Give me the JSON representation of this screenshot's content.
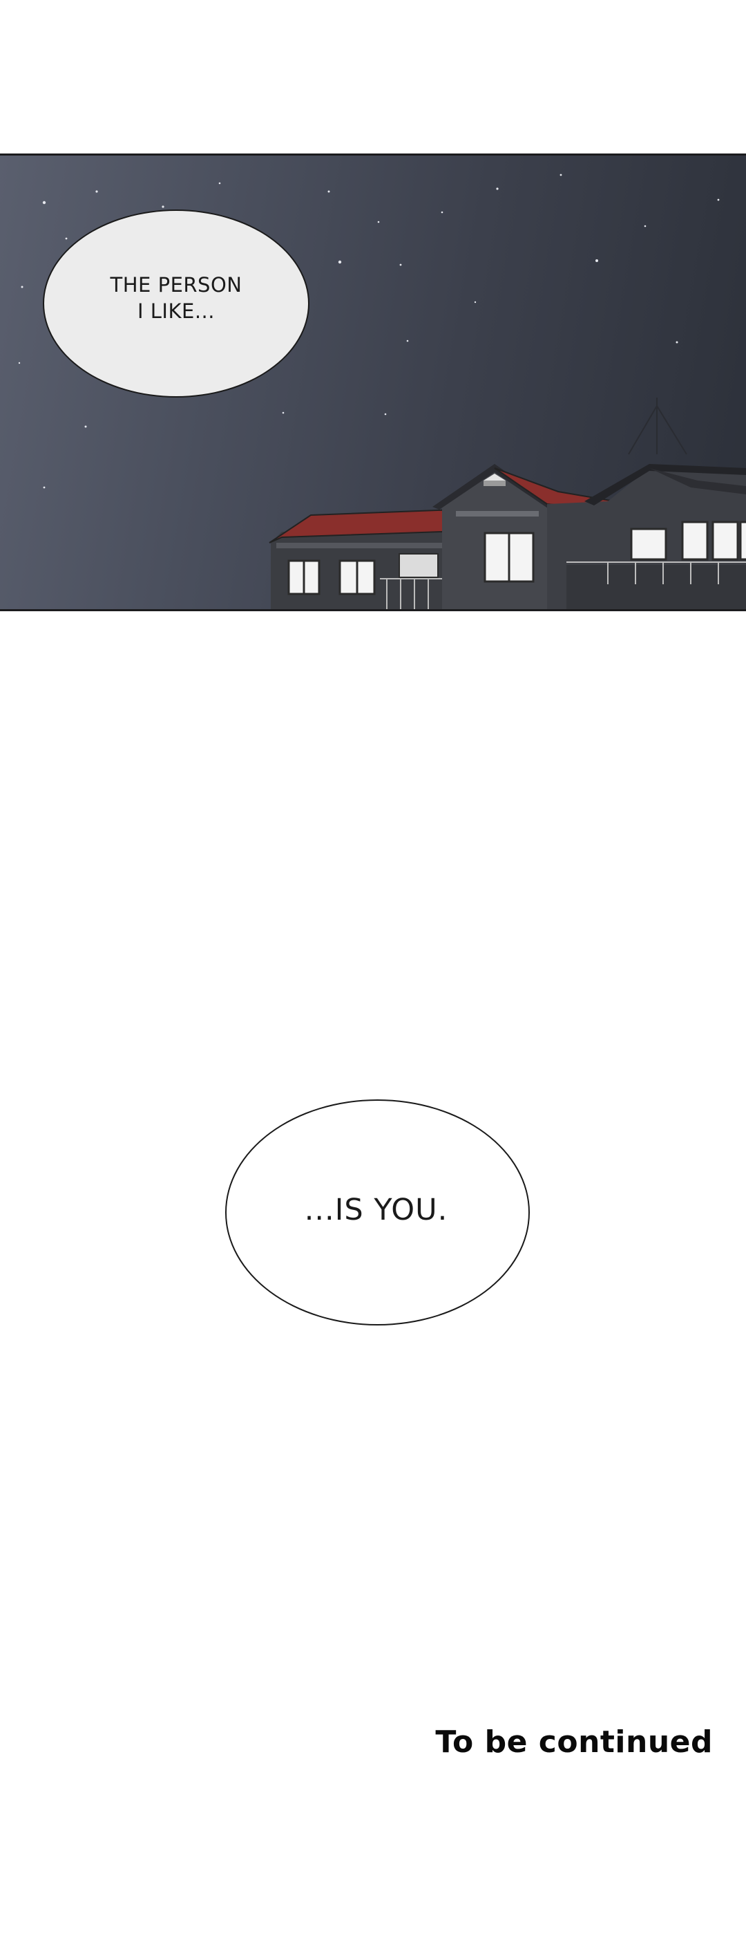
{
  "panel": {
    "description_icon": "night-sky-houses-illustration",
    "colors": {
      "sky_top": "#5a5f6e",
      "sky_bottom": "#2c3039",
      "roof": "#8a2f2c",
      "window_light": "#f4f4f4"
    }
  },
  "bubbles": {
    "night_line": "THE PERSON\nI LIKE...",
    "reply_line": "...IS YOU."
  },
  "footer": {
    "continued": "To be continued"
  }
}
